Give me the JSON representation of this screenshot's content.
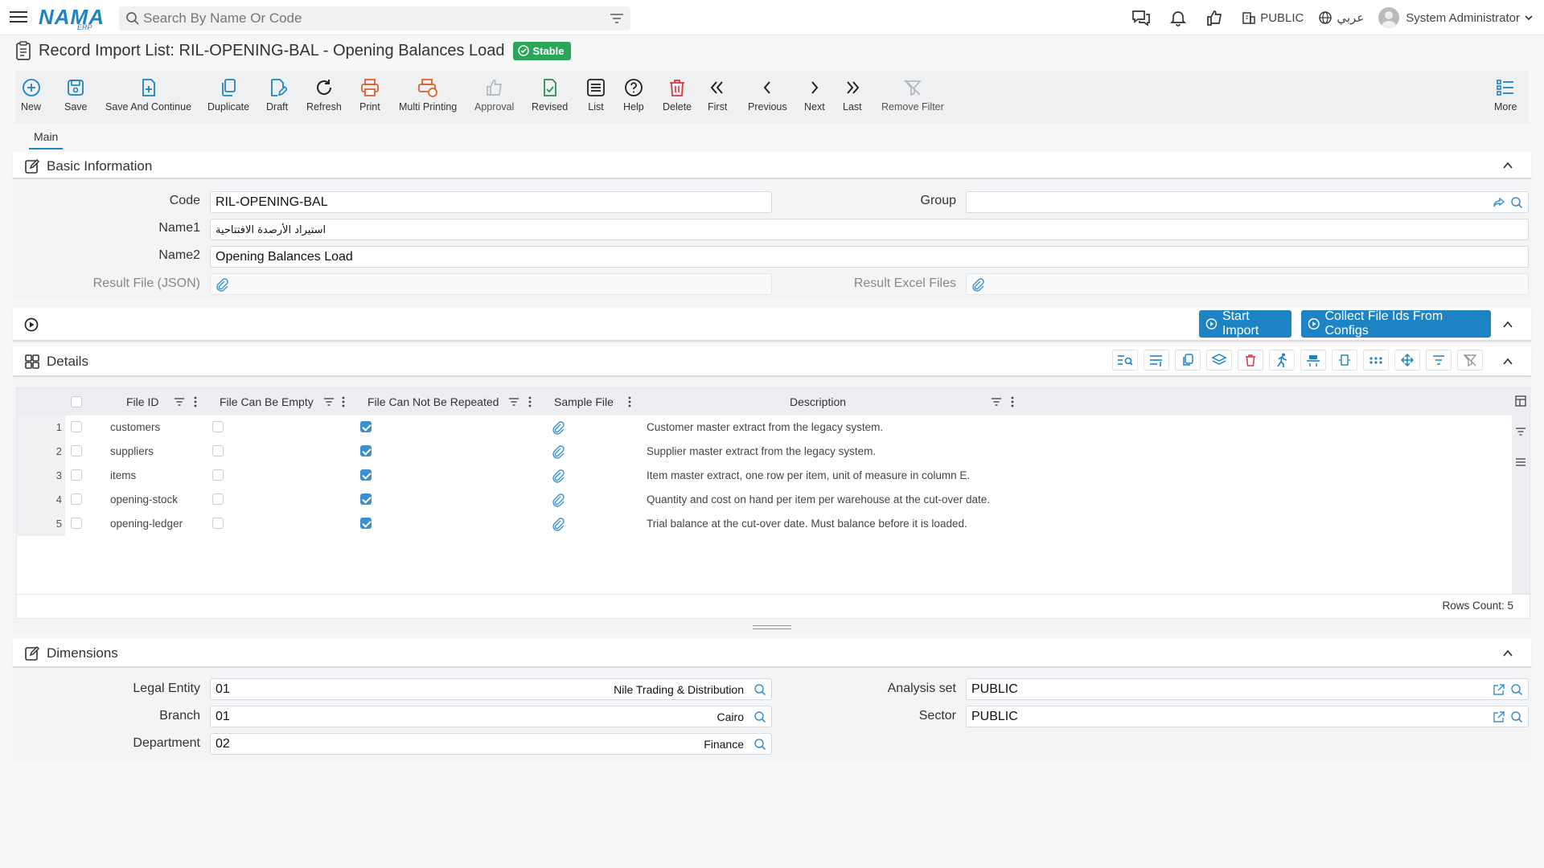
{
  "topbar": {
    "logo": "NAMA",
    "logo_sub": "ERP",
    "search_placeholder": "Search By Name Or Code",
    "company": "PUBLIC",
    "language": "عربي",
    "user": "System Administrator"
  },
  "title": {
    "text": "Record Import List: RIL-OPENING-BAL - Opening Balances Load",
    "status": "Stable"
  },
  "toolbar": {
    "new": "New",
    "save": "Save",
    "save_continue": "Save And Continue",
    "duplicate": "Duplicate",
    "draft": "Draft",
    "refresh": "Refresh",
    "print": "Print",
    "multi_printing": "Multi Printing",
    "approval": "Approval",
    "revised": "Revised",
    "list": "List",
    "help": "Help",
    "delete": "Delete",
    "first": "First",
    "previous": "Previous",
    "next": "Next",
    "last": "Last",
    "remove_filter": "Remove Filter",
    "more": "More"
  },
  "tabs": {
    "main": "Main"
  },
  "basic": {
    "title": "Basic Information",
    "code_label": "Code",
    "code_value": "RIL-OPENING-BAL",
    "group_label": "Group",
    "group_value": "",
    "name1_label": "Name1",
    "name1_value": "استيراد الأرصدة الافتتاحية",
    "name2_label": "Name2",
    "name2_value": "Opening Balances Load",
    "result_json_label": "Result File (JSON)",
    "result_excel_label": "Result Excel Files"
  },
  "actions": {
    "start_import": "Start Import",
    "collect_ids": "Collect File Ids From Configs"
  },
  "details": {
    "title": "Details",
    "columns": {
      "file_id": "File ID",
      "can_be_empty": "File Can Be Empty",
      "not_repeated": "File Can Not Be Repeated",
      "sample_file": "Sample File",
      "description": "Description"
    },
    "rows": [
      {
        "n": "1",
        "file_id": "customers",
        "can_be_empty": false,
        "not_repeated": true,
        "description": "Customer master extract from the legacy system."
      },
      {
        "n": "2",
        "file_id": "suppliers",
        "can_be_empty": false,
        "not_repeated": true,
        "description": "Supplier master extract from the legacy system."
      },
      {
        "n": "3",
        "file_id": "items",
        "can_be_empty": false,
        "not_repeated": true,
        "description": "Item master extract, one row per item, unit of measure in column E."
      },
      {
        "n": "4",
        "file_id": "opening-stock",
        "can_be_empty": false,
        "not_repeated": true,
        "description": "Quantity and cost on hand per item per warehouse at the cut-over date."
      },
      {
        "n": "5",
        "file_id": "opening-ledger",
        "can_be_empty": false,
        "not_repeated": true,
        "description": "Trial balance at the cut-over date. Must balance before it is loaded."
      }
    ],
    "rows_count": "Rows Count: 5"
  },
  "dimensions": {
    "title": "Dimensions",
    "legal_entity_label": "Legal Entity",
    "legal_entity_code": "01",
    "legal_entity_name": "Nile Trading & Distribution",
    "branch_label": "Branch",
    "branch_code": "01",
    "branch_name": "Cairo",
    "department_label": "Department",
    "department_code": "02",
    "department_name": "Finance",
    "analysis_set_label": "Analysis set",
    "analysis_set_value": "PUBLIC",
    "sector_label": "Sector",
    "sector_value": "PUBLIC"
  },
  "colors": {
    "accent": "#1d83c4",
    "stable_badge": "#2aa55a",
    "print_orange": "#e5602a",
    "delete_red": "#d9363e",
    "revised_green": "#2f8f4e"
  }
}
